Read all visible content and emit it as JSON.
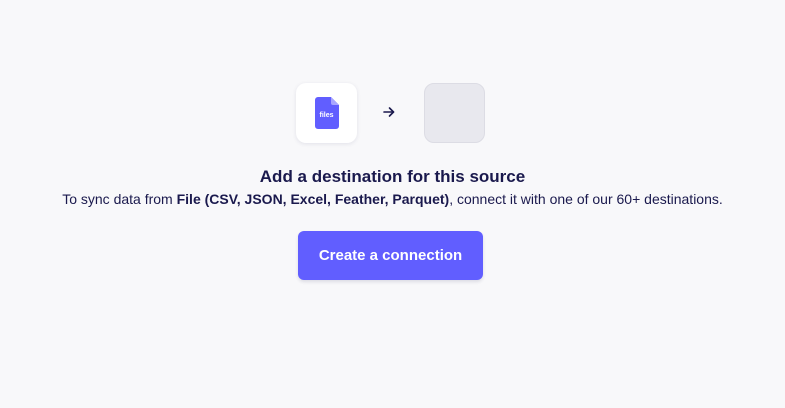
{
  "source": {
    "icon": "file-icon",
    "icon_text": "files",
    "icon_color": "#615eff"
  },
  "connector": {
    "icon": "arrow-right-icon"
  },
  "destination": {
    "icon": "empty-destination-placeholder"
  },
  "heading": "Add a destination for this source",
  "description": {
    "prefix": "To sync data from ",
    "source_name": "File (CSV, JSON, Excel, Feather, Parquet)",
    "suffix": ", connect it with one of our 60+ destinations."
  },
  "create_button": {
    "label": "Create a connection",
    "color": "#615eff"
  },
  "colors": {
    "background": "#f8f8fa",
    "text": "#1a194d",
    "accent": "#615eff"
  }
}
